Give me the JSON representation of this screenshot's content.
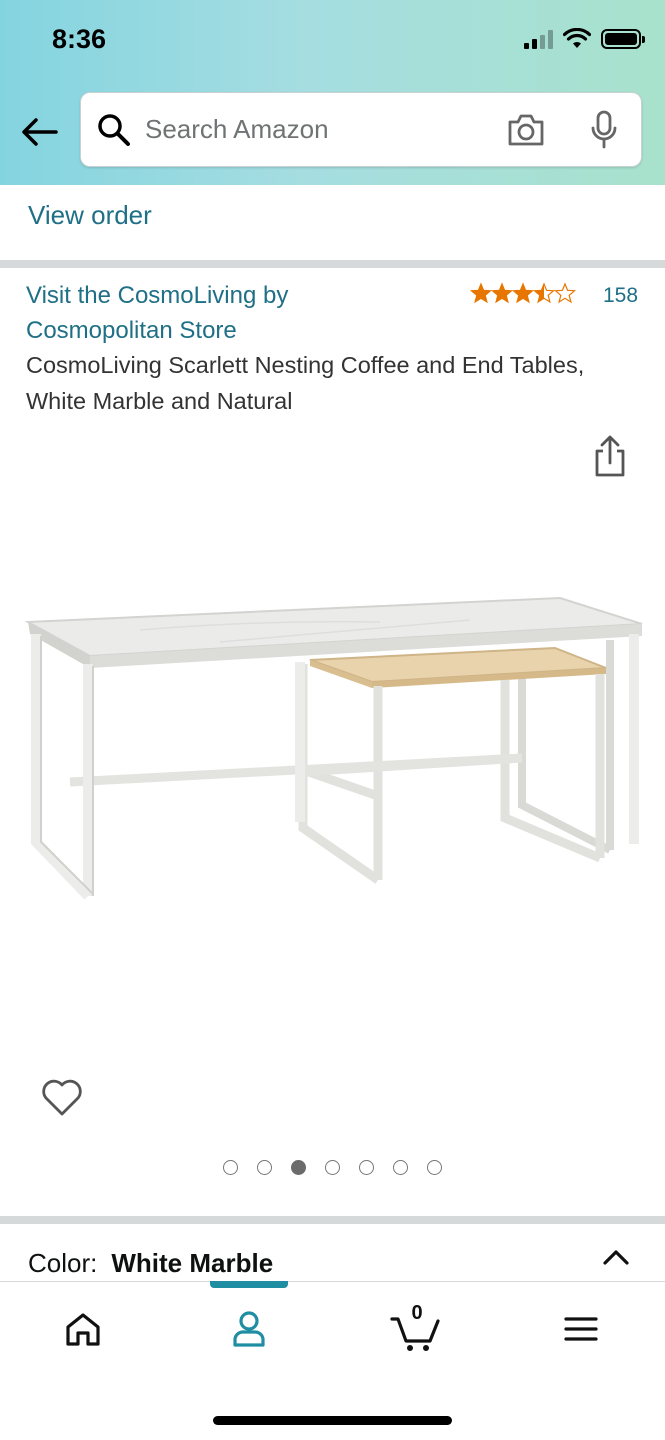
{
  "status_bar": {
    "time": "8:36"
  },
  "search": {
    "placeholder": "Search Amazon"
  },
  "order": {
    "view_order_label": "View order"
  },
  "product": {
    "store_link": "Visit the CosmoLiving by Cosmopolitan Store",
    "rating": 3.5,
    "rating_count": "158",
    "title": "CosmoLiving Scarlett Nesting Coffee and End Tables, White Marble and Natural",
    "image_count": 7,
    "active_image_index": 2
  },
  "color_option": {
    "label": "Color:",
    "value": "White Marble"
  },
  "bottom_nav": {
    "items": [
      "home",
      "account",
      "cart",
      "menu"
    ],
    "active": "account",
    "cart_count": "0"
  },
  "colors": {
    "link": "#1f6f86",
    "accent": "#1f8ea3",
    "star": "#e77600",
    "header_gradient_start": "#84d4e0",
    "header_gradient_end": "#a8e2cc"
  }
}
